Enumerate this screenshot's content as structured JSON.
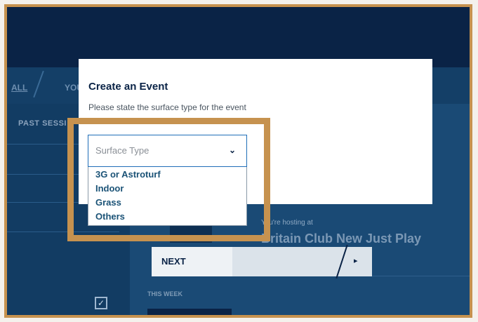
{
  "background": {
    "tabs": [
      "ALL",
      "YOU"
    ],
    "past_sessions_label": "PAST SESSI",
    "hosting_label": "You're hosting at",
    "club_name": "Britain Club New Just Play",
    "next_label": "NEXT",
    "next_arrow": "▸",
    "this_week_label": "THIS WEEK",
    "checkbox_mark": "✓"
  },
  "modal": {
    "title": "Create an Event",
    "subtitle": "Please state the surface type for the event"
  },
  "surface_select": {
    "placeholder": "Surface Type",
    "chevron": "⌄",
    "options": [
      "3G or Astroturf",
      "Indoor",
      "Grass",
      "Others"
    ]
  },
  "colors": {
    "highlight": "#c6924f",
    "navy": "#0a2346",
    "option_text": "#1a5276",
    "select_border": "#1f6eb8"
  }
}
